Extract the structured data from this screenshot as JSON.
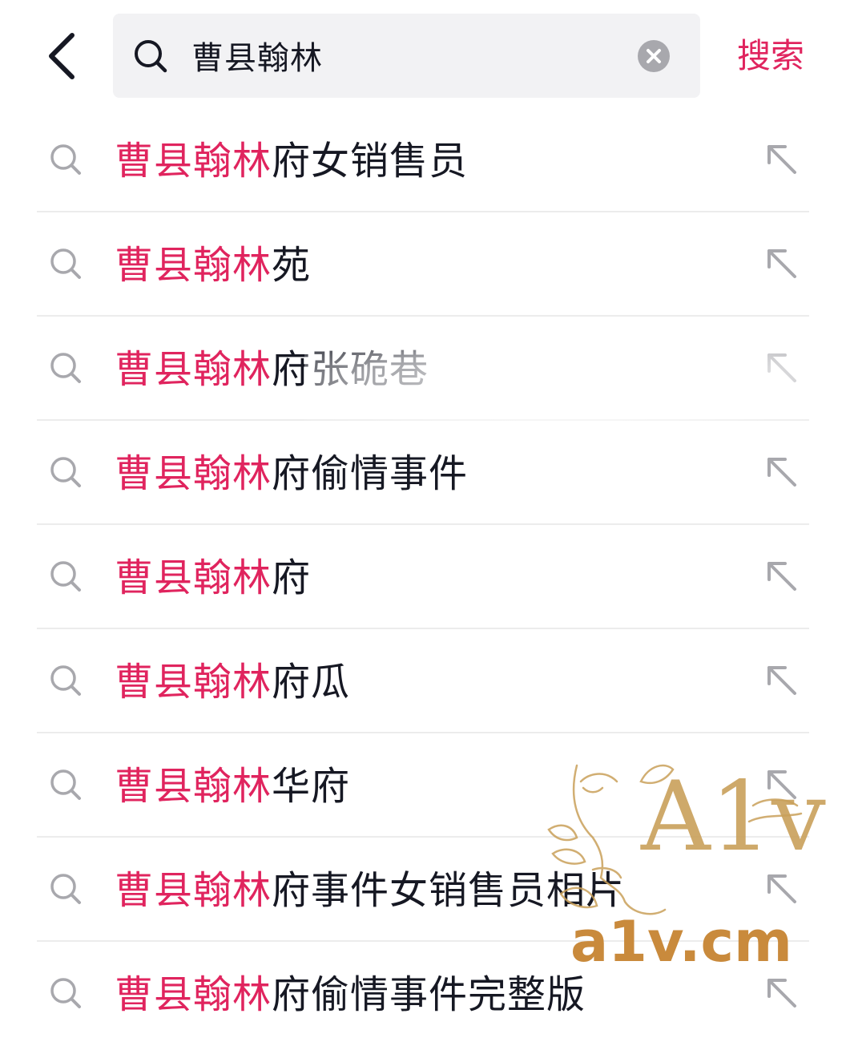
{
  "header": {
    "back_icon": "chevron-left-icon",
    "search_icon": "search-icon",
    "query": "曹县翰林",
    "clear_icon": "clear-icon",
    "search_button": "搜索"
  },
  "colors": {
    "accent": "#e0245e",
    "text": "#161823",
    "icon_gray": "#a8a8ad",
    "search_bg": "#f2f2f4",
    "watermark_gold": "#c9a05a"
  },
  "suggestions": [
    {
      "highlight": "曹县翰林",
      "rest": "府女销售员"
    },
    {
      "highlight": "曹县翰林",
      "rest": "苑"
    },
    {
      "highlight": "曹县翰林",
      "rest": "府张硊巷"
    },
    {
      "highlight": "曹县翰林",
      "rest": "府偷情事件"
    },
    {
      "highlight": "曹县翰林",
      "rest": "府"
    },
    {
      "highlight": "曹县翰林",
      "rest": "府瓜"
    },
    {
      "highlight": "曹县翰林",
      "rest": "华府"
    },
    {
      "highlight": "曹县翰林",
      "rest": "府事件女销售员相片"
    },
    {
      "highlight": "曹县翰林",
      "rest": "府偷情事件完整版"
    }
  ],
  "row_icons": {
    "left": "search-icon",
    "right": "arrow-up-left-icon"
  },
  "watermark": {
    "logo": "A1v",
    "domain": "a1v.cm"
  }
}
